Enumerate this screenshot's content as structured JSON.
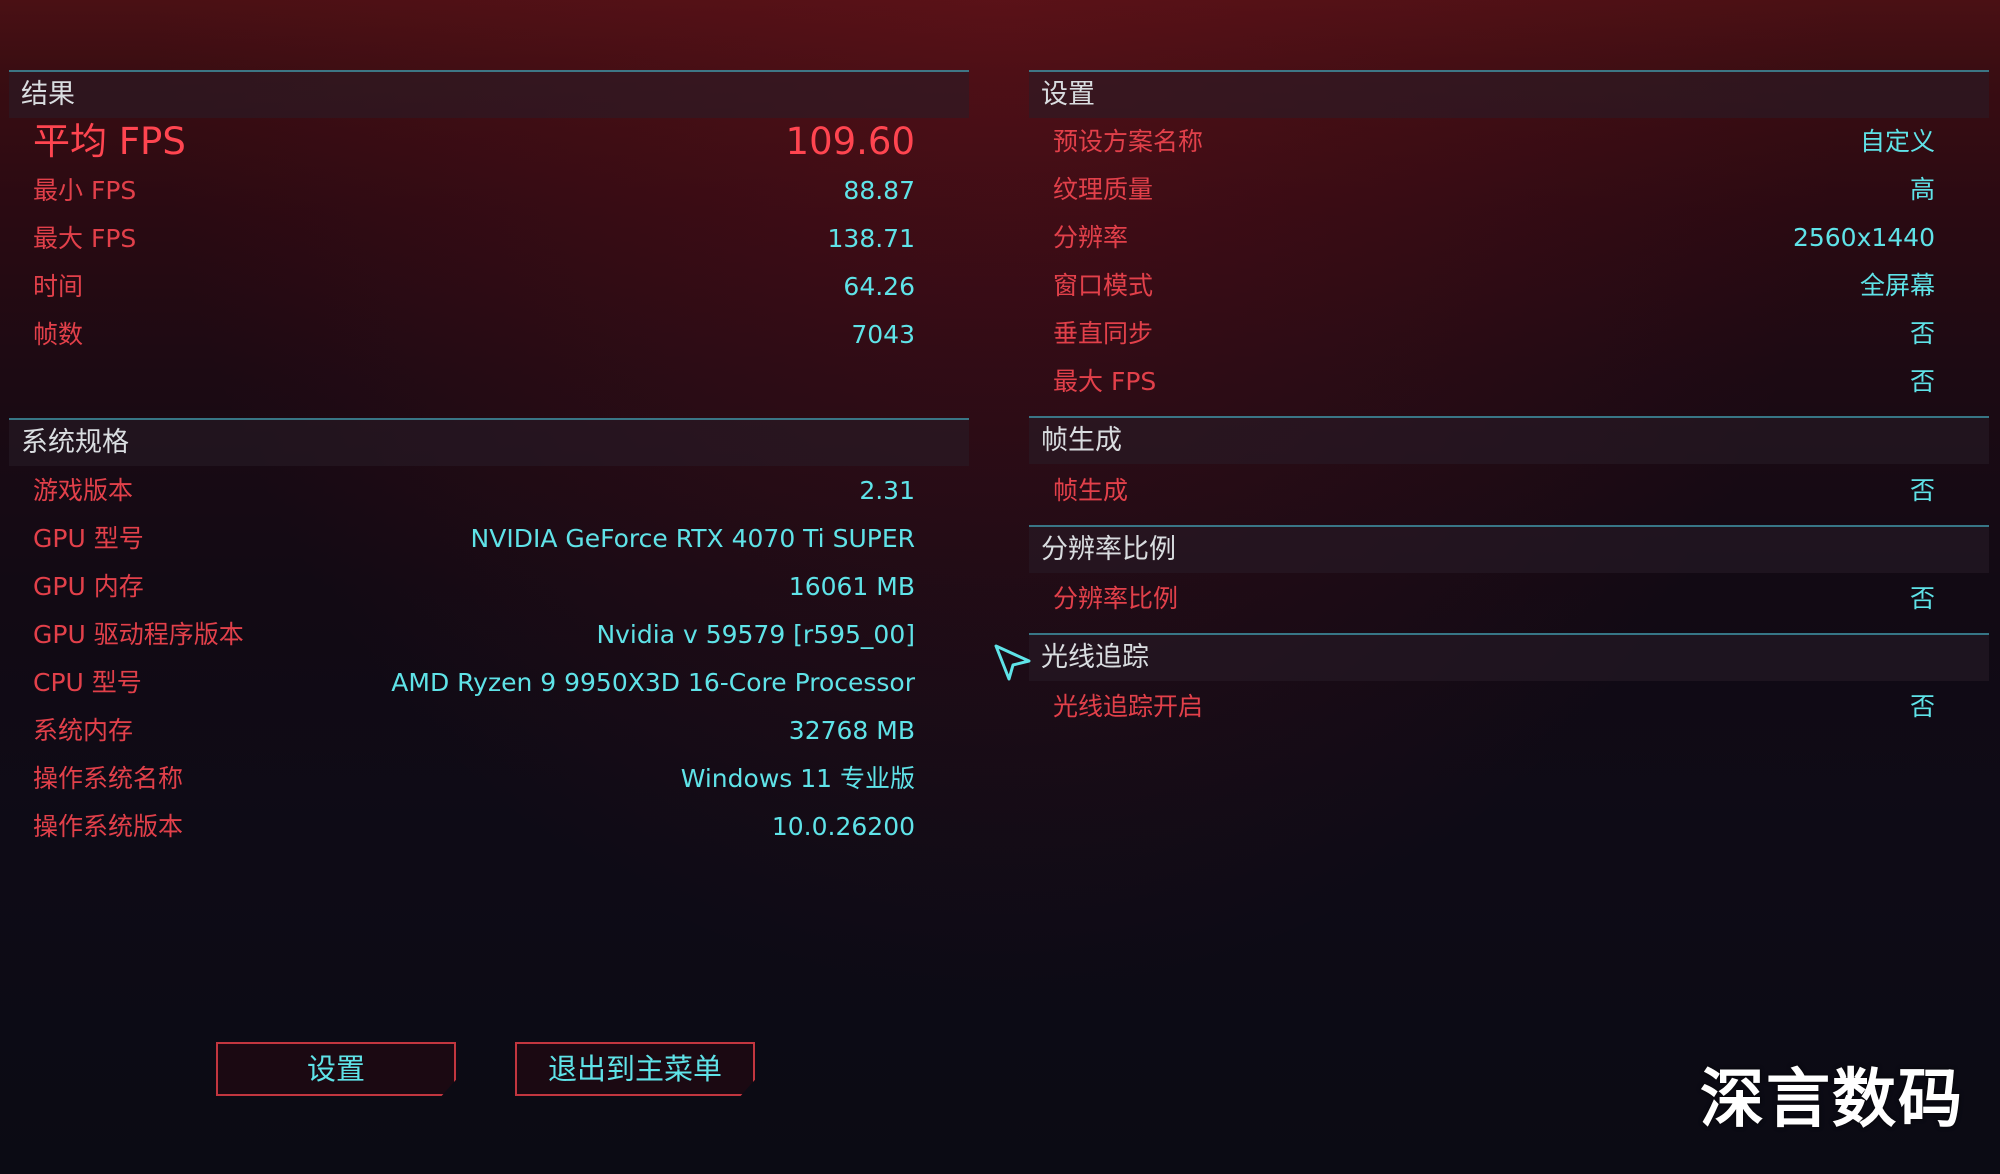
{
  "results": {
    "header": "结果",
    "avg_fps_label": "平均 FPS",
    "avg_fps_value": "109.60",
    "rows": [
      {
        "label": "最小 FPS",
        "value": "88.87"
      },
      {
        "label": "最大 FPS",
        "value": "138.71"
      },
      {
        "label": "时间",
        "value": "64.26"
      },
      {
        "label": "帧数",
        "value": "7043"
      }
    ]
  },
  "system_specs": {
    "header": "系统规格",
    "rows": [
      {
        "label": "游戏版本",
        "value": "2.31"
      },
      {
        "label": "GPU 型号",
        "value": "NVIDIA GeForce RTX 4070 Ti SUPER"
      },
      {
        "label": "GPU 内存",
        "value": "16061 MB"
      },
      {
        "label": "GPU 驱动程序版本",
        "value": "Nvidia v 59579 [r595_00]"
      },
      {
        "label": "CPU 型号",
        "value": "AMD Ryzen 9 9950X3D 16-Core Processor"
      },
      {
        "label": "系统内存",
        "value": "32768 MB"
      },
      {
        "label": "操作系统名称",
        "value": "Windows 11 专业版"
      },
      {
        "label": "操作系统版本",
        "value": "10.0.26200"
      }
    ]
  },
  "settings": {
    "header": "设置",
    "rows": [
      {
        "label": "预设方案名称",
        "value": "自定义"
      },
      {
        "label": "纹理质量",
        "value": "高"
      },
      {
        "label": "分辨率",
        "value": "2560x1440"
      },
      {
        "label": "窗口模式",
        "value": "全屏幕"
      },
      {
        "label": "垂直同步",
        "value": "否"
      },
      {
        "label": "最大 FPS",
        "value": "否"
      }
    ]
  },
  "frame_gen": {
    "header": "帧生成",
    "rows": [
      {
        "label": "帧生成",
        "value": "否"
      }
    ]
  },
  "resolution_scaling": {
    "header": "分辨率比例",
    "rows": [
      {
        "label": "分辨率比例",
        "value": "否"
      }
    ]
  },
  "ray_tracing": {
    "header": "光线追踪",
    "rows": [
      {
        "label": "光线追踪开启",
        "value": "否"
      }
    ]
  },
  "buttons": {
    "settings": "设置",
    "exit_to_menu": "退出到主菜单"
  },
  "watermark": "深言数码",
  "colors": {
    "label_red": "#e2404a",
    "value_cyan": "#5fe3e8",
    "divider_teal": "#3d8a9a",
    "header_text": "#d9dde0"
  }
}
